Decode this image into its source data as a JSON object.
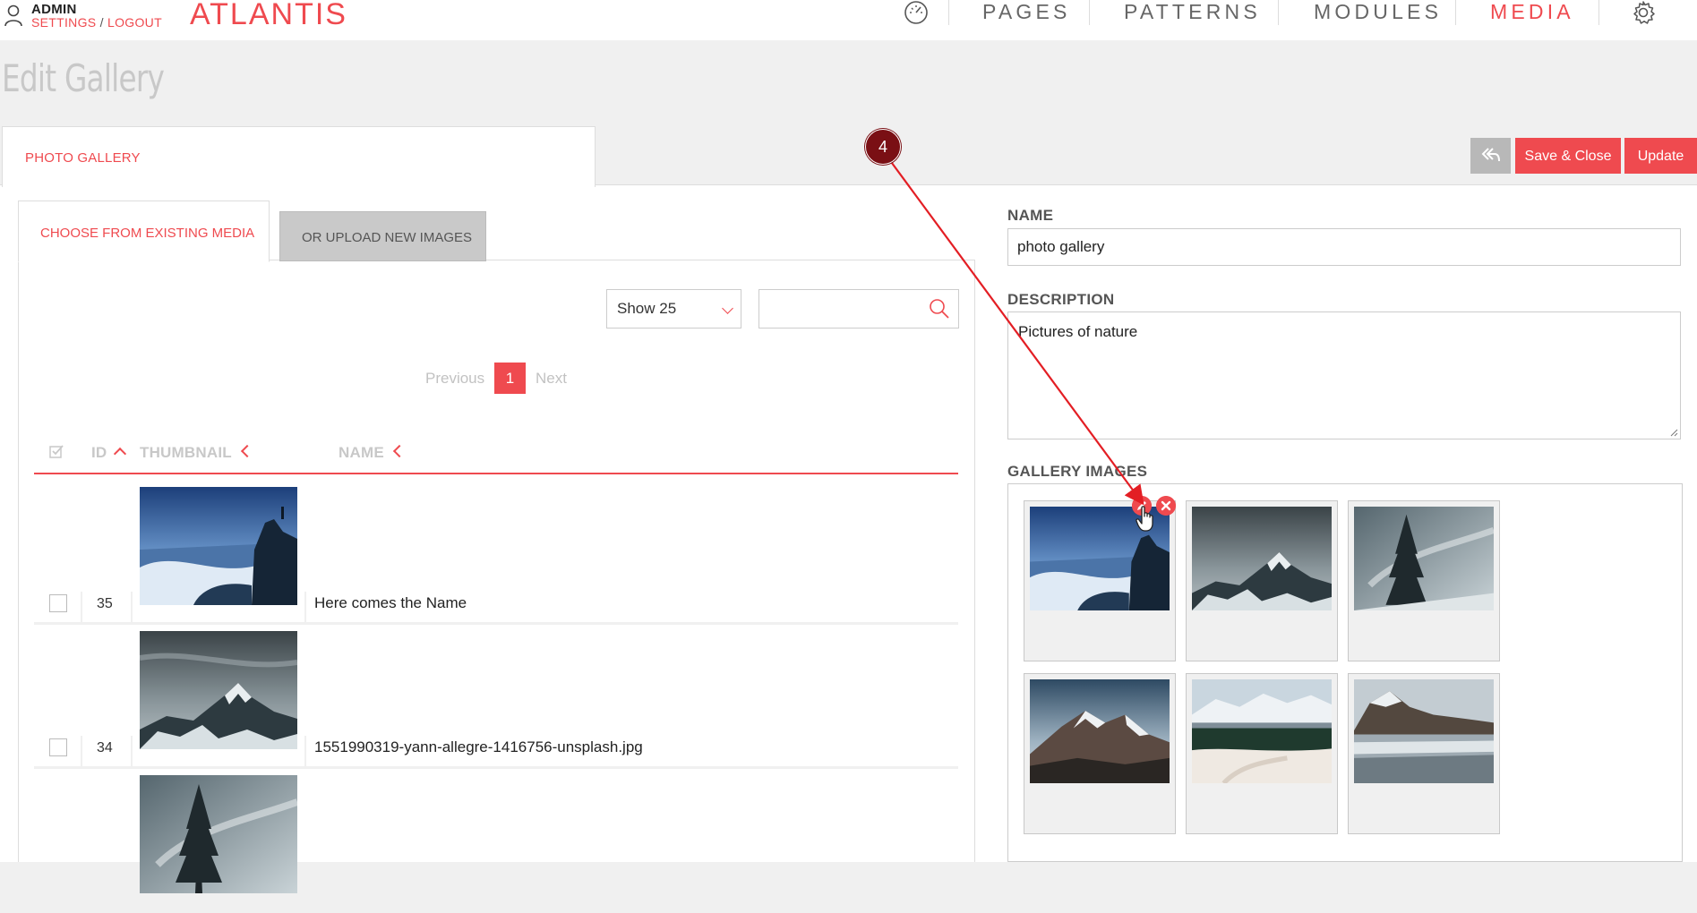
{
  "user": {
    "name": "ADMIN",
    "settings_label": "SETTINGS",
    "separator": " / ",
    "logout_label": "LOGOUT"
  },
  "brand": "ATLANTIS",
  "nav": {
    "items": [
      {
        "label": "PAGES",
        "active": false
      },
      {
        "label": "PATTERNS",
        "active": false
      },
      {
        "label": "MODULES",
        "active": false
      },
      {
        "label": "MEDIA",
        "active": true
      }
    ],
    "icons": [
      "dashboard-icon",
      "gear-icon"
    ]
  },
  "page": {
    "title": "Edit Gallery",
    "tab_label": "PHOTO GALLERY"
  },
  "actions": {
    "back_icon": "back-icon",
    "save_close_label": "Save & Close",
    "update_label": "Update"
  },
  "media": {
    "tabs": [
      "CHOOSE FROM EXISTING MEDIA",
      "OR UPLOAD NEW IMAGES"
    ],
    "show_value": "Show 25",
    "search_value": "",
    "pagination": {
      "previous": "Previous",
      "current": "1",
      "next": "Next"
    },
    "columns": [
      "ID",
      "THUMBNAIL",
      "NAME"
    ],
    "rows": [
      {
        "id": "35",
        "name": "Here comes the Name",
        "thumb": "coast"
      },
      {
        "id": "34",
        "name": "1551990319-yann-allegre-1416756-unsplash.jpg",
        "thumb": "mountain"
      },
      {
        "id": "",
        "name": "",
        "thumb": "tree"
      }
    ]
  },
  "form": {
    "name_label": "NAME",
    "name_value": "photo gallery",
    "description_label": "DESCRIPTION",
    "description_value": "Pictures of nature",
    "gallery_label": "GALLERY IMAGES",
    "gallery_images": [
      "coast",
      "mountain",
      "tree",
      "peak",
      "river",
      "lake"
    ]
  },
  "annotation": {
    "step": "4"
  },
  "colors": {
    "accent": "#ef4a4f",
    "annotation": "#7a0f14",
    "background": "#f0f0f0"
  }
}
